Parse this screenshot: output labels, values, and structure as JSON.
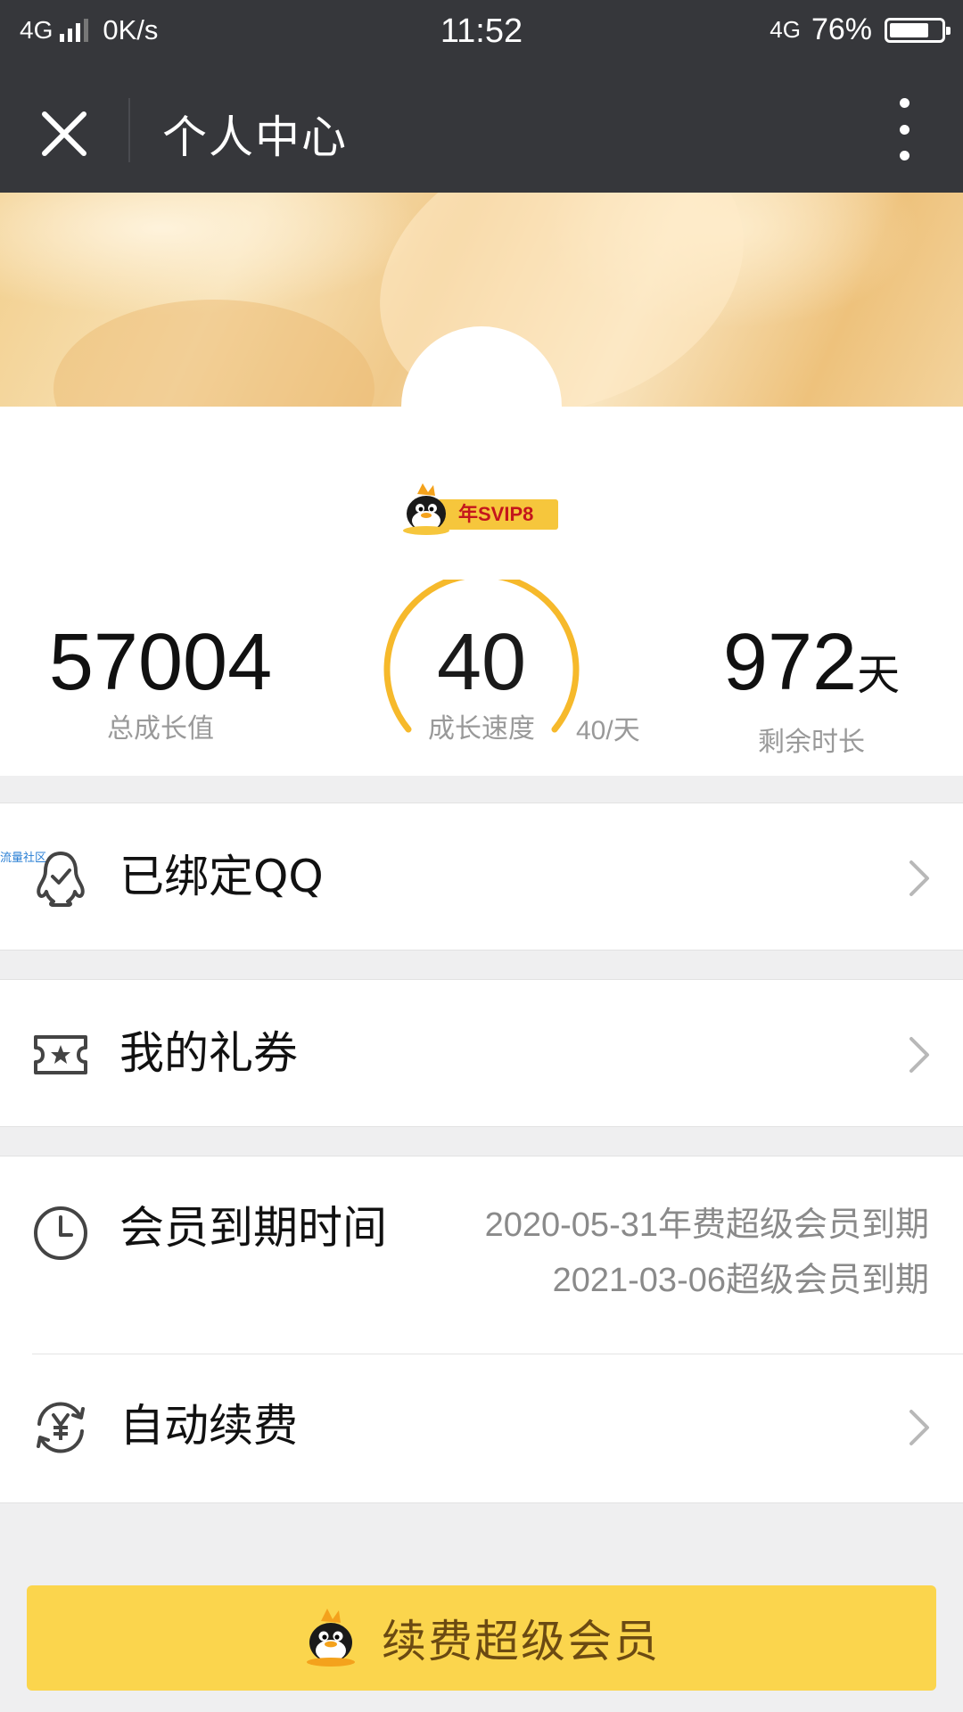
{
  "status_bar": {
    "network": "4G",
    "speed": "0K/s",
    "time": "11:52",
    "network_right": "4G",
    "battery": "76%",
    "battery_level": 0.76
  },
  "nav": {
    "title": "个人中心",
    "close_icon": "close-icon",
    "more_icon": "more-vertical-icon"
  },
  "profile": {
    "badge": "年SVIP8"
  },
  "stats": {
    "total_growth": {
      "value": "57004",
      "label": "总成长值"
    },
    "growth_speed": {
      "value": "40",
      "label": "成长速度",
      "rate": "40/天"
    },
    "remaining": {
      "value": "972",
      "unit": "天",
      "label": "剩余时长"
    }
  },
  "menu": {
    "qq": {
      "label": "已绑定QQ",
      "watermark": "流量社区"
    },
    "coupons": {
      "label": "我的礼券"
    },
    "expiry": {
      "label": "会员到期时间",
      "lines": [
        "2020-05-31年费超级会员到期",
        "2021-03-06超级会员到期"
      ]
    },
    "auto_renew": {
      "label": "自动续费"
    }
  },
  "renew_button": {
    "label": "续费超级会员"
  },
  "colors": {
    "nav_bg": "#36373b",
    "accent": "#fbd54d",
    "gauge": "#f6b92b"
  }
}
